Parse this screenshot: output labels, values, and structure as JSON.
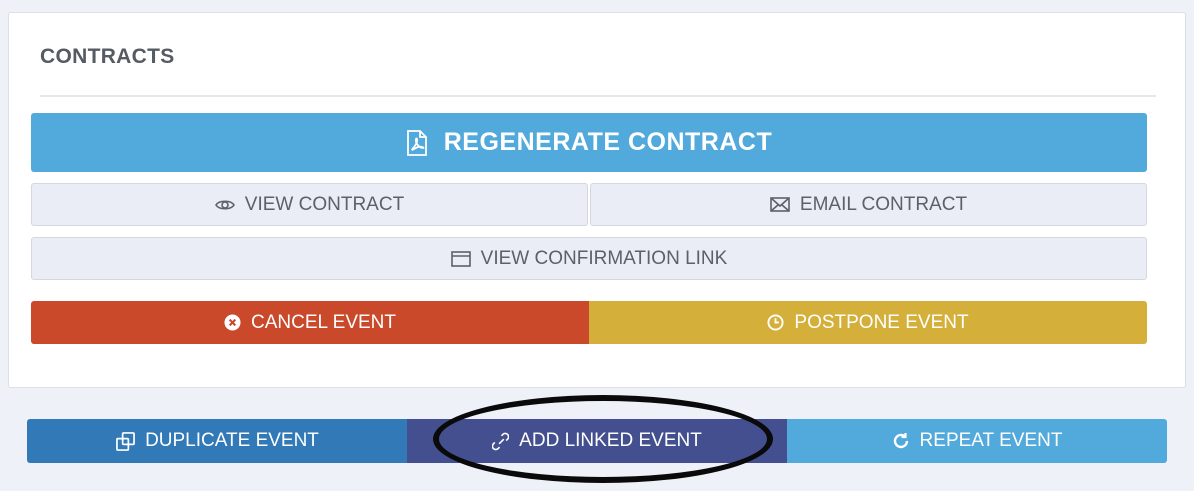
{
  "contracts": {
    "title": "CONTRACTS",
    "regenerate_label": "REGENERATE CONTRACT",
    "view_label": "VIEW CONTRACT",
    "email_label": "EMAIL CONTRACT",
    "confirmation_label": "VIEW CONFIRMATION LINK",
    "cancel_label": "CANCEL EVENT",
    "postpone_label": "POSTPONE EVENT"
  },
  "actions": {
    "duplicate_label": "DUPLICATE EVENT",
    "linked_label": "ADD LINKED EVENT",
    "repeat_label": "REPEAT EVENT"
  },
  "icons": {
    "regenerate": "pdf-file-icon",
    "view": "eye-icon",
    "email": "envelope-icon",
    "confirmation": "browser-window-icon",
    "cancel": "x-circle-icon",
    "postpone": "clock-icon",
    "duplicate": "copy-icon",
    "linked": "link-icon",
    "repeat": "refresh-icon"
  },
  "colors": {
    "regenerate": "#52a9dc",
    "cancel": "#c9492a",
    "postpone": "#d4af3a",
    "duplicate": "#3179b7",
    "linked": "#434f8e",
    "repeat": "#52a9dc",
    "annotation": "#0a0a0a"
  }
}
